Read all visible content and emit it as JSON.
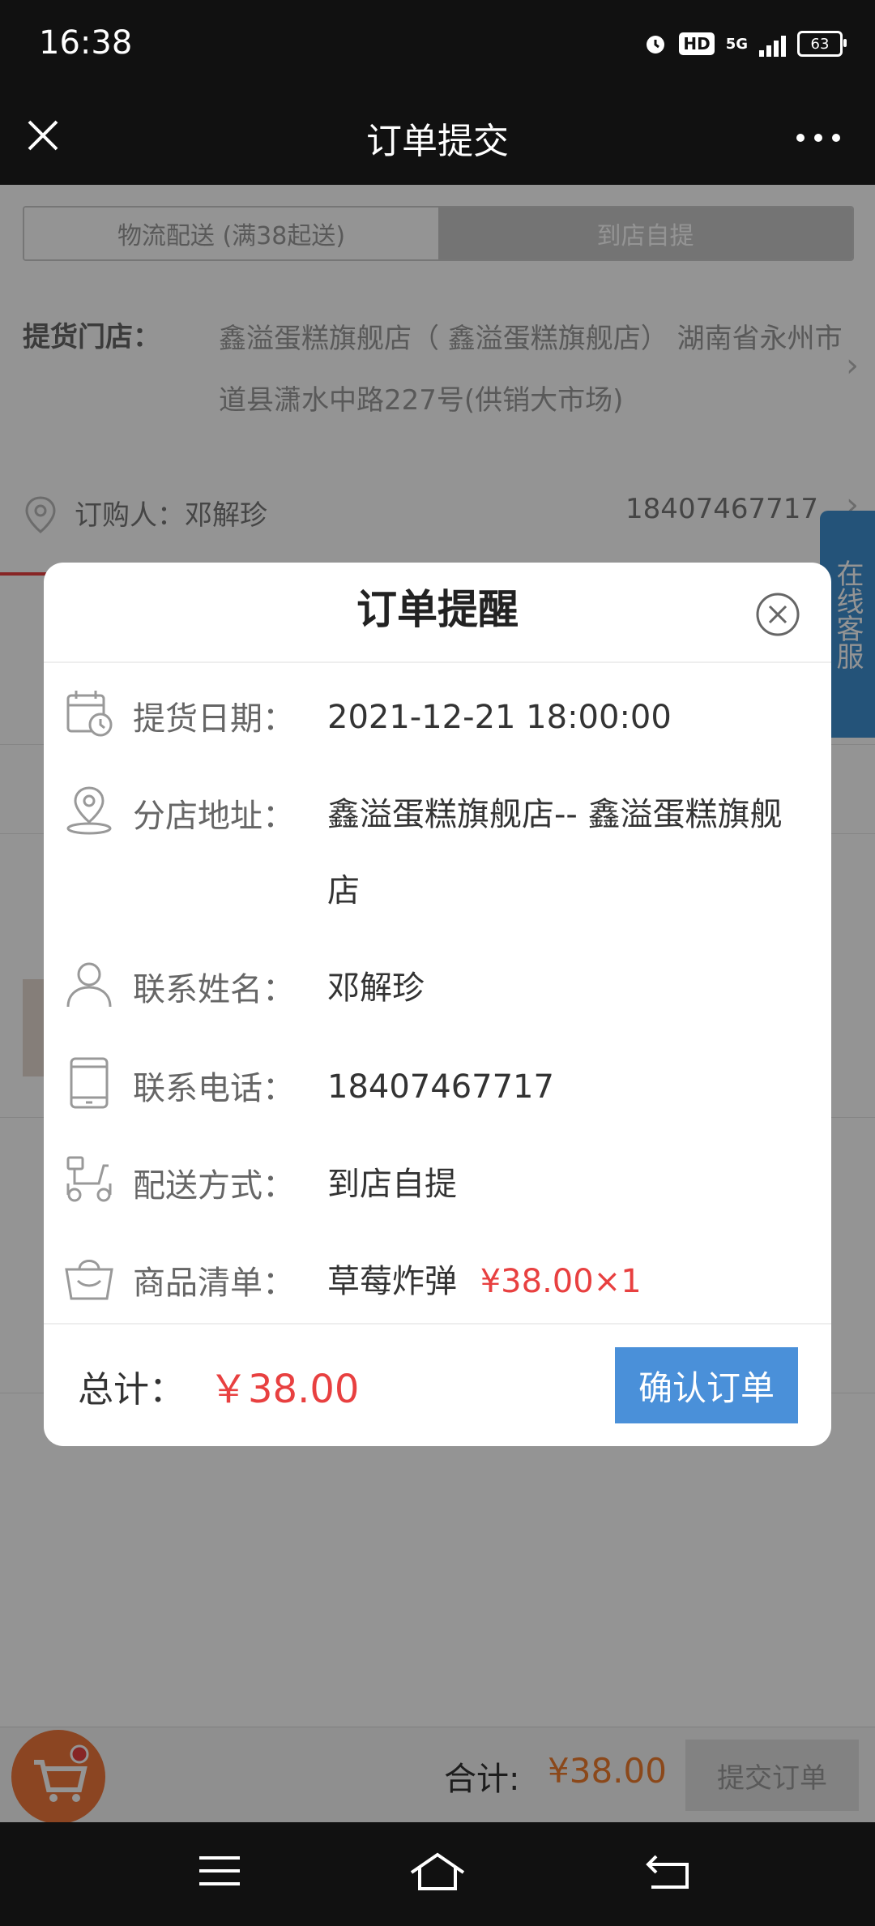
{
  "status_bar": {
    "time": "16:38",
    "network": "5G",
    "hd": "HD",
    "battery": "63"
  },
  "title_bar": {
    "title": "订单提交"
  },
  "delivery_tabs": {
    "logistics": "物流配送 (满38起送)",
    "pickup": "到店自提"
  },
  "store": {
    "label": "提货门店：",
    "address": "鑫溢蛋糕旗舰店（ 鑫溢蛋糕旗舰店） 湖南省永州市道县潇水中路227号(供销大市场)"
  },
  "buyer": {
    "label": "订购人：邓解珍",
    "phone": "18407467717"
  },
  "service": {
    "label": "在线客服"
  },
  "bottom_bar": {
    "total_label": "合计:",
    "total_amount": "¥38.00",
    "submit_label": "提交订单"
  },
  "modal": {
    "title": "订单提醒",
    "rows": [
      {
        "icon": "calendar-clock-icon",
        "label": "提货日期：",
        "value": "2021-12-21 18:00:00"
      },
      {
        "icon": "location-pin-icon",
        "label": "分店地址：",
        "value": "鑫溢蛋糕旗舰店-- 鑫溢蛋糕旗舰店"
      },
      {
        "icon": "person-icon",
        "label": "联系姓名：",
        "value": "邓解珍"
      },
      {
        "icon": "tablet-icon",
        "label": "联系电话：",
        "value": "18407467717"
      },
      {
        "icon": "scooter-icon",
        "label": "配送方式：",
        "value": "到店自提"
      },
      {
        "icon": "shopping-bag-icon",
        "label": "商品清单：",
        "value": "草莓炸弹",
        "price": "¥38.00×1"
      }
    ],
    "total_label": "总计：",
    "total_amount": "￥38.00",
    "confirm_label": "确认订单"
  }
}
